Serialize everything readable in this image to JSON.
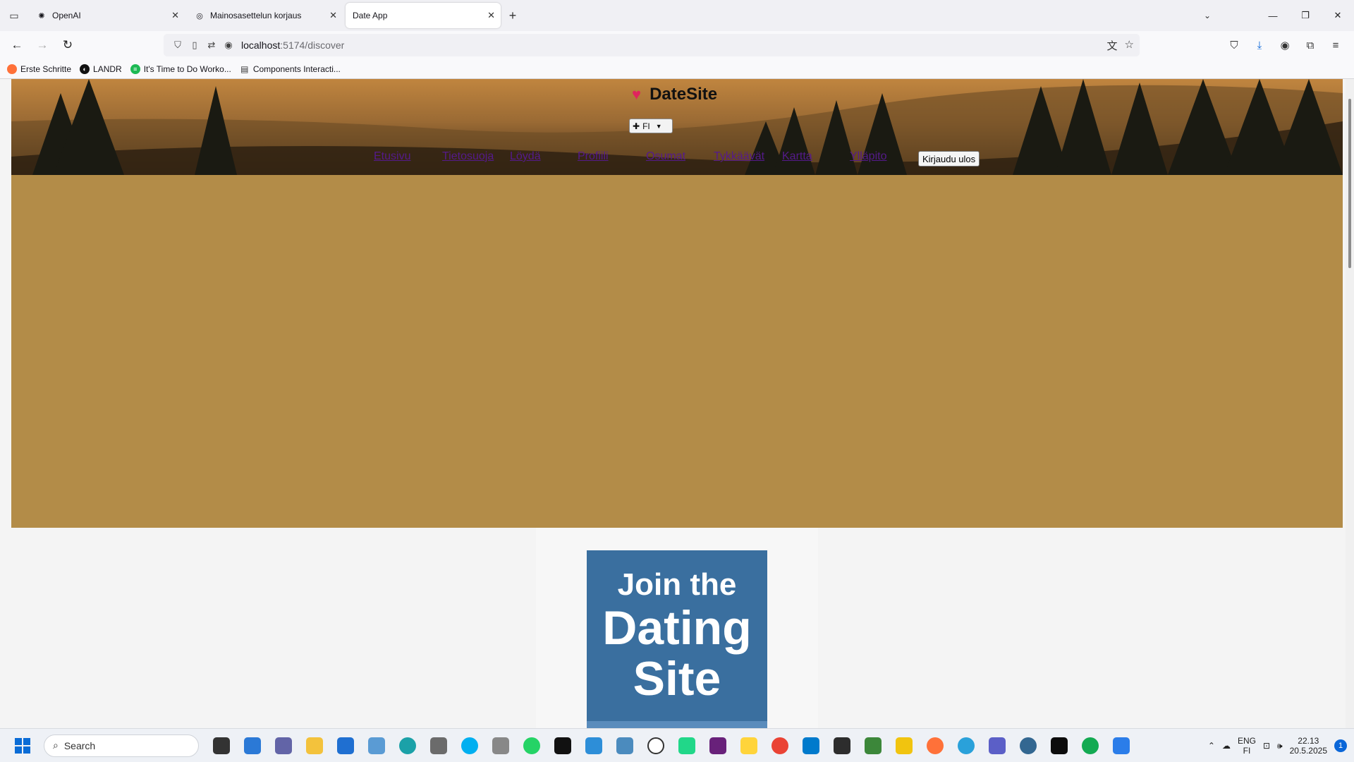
{
  "browser": {
    "tabs": [
      {
        "title": "OpenAI",
        "active": false
      },
      {
        "title": "Mainosasettelun korjaus",
        "active": false
      },
      {
        "title": "Date App",
        "active": true
      }
    ],
    "url_host": "localhost",
    "url_path": ":5174/discover",
    "bookmarks": [
      {
        "label": "Erste Schritte",
        "icon": "firefox-icon",
        "color": "#ff7139"
      },
      {
        "label": "LANDR",
        "icon": "landr-icon",
        "color": "#111111"
      },
      {
        "label": "It's Time to Do Worko...",
        "icon": "spotify-icon",
        "color": "#1db954"
      },
      {
        "label": "Components Interacti...",
        "icon": "document-icon",
        "color": "#555555"
      }
    ]
  },
  "site": {
    "brand": "DateSite",
    "brand_heart_color": "#e0245e",
    "language": "FI",
    "nav": [
      {
        "label": "Etusivu"
      },
      {
        "label": "Tietosuoja"
      },
      {
        "label": "Löydä"
      },
      {
        "label": "Profiili"
      },
      {
        "label": "Osumat"
      },
      {
        "label": "Tykkäävät"
      },
      {
        "label": "Kartta"
      },
      {
        "label": "Ylläpito"
      }
    ],
    "logout_label": "Kirjaudu ulos",
    "hero_color": "#b38c48",
    "link_color": "#551a8b"
  },
  "ad": {
    "line1": "Join the",
    "line2": "Dating",
    "line3": "Site",
    "color": "#3a6f9f"
  },
  "taskbar": {
    "search_placeholder": "Search",
    "language": "ENG",
    "keyboard": "FI",
    "time": "22.13",
    "date": "20.5.2025",
    "notification_count": "1"
  }
}
